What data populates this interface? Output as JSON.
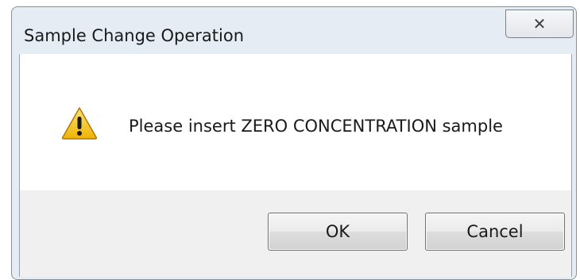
{
  "window": {
    "title": "Sample Change Operation",
    "close_glyph": "✕"
  },
  "message": {
    "icon": "warning-icon",
    "text": "Please insert ZERO CONCENTRATION sample"
  },
  "buttons": {
    "ok_label": "OK",
    "cancel_label": "Cancel"
  },
  "colors": {
    "frame": "#e6ecf3",
    "warning_yellow": "#f3c019",
    "button_area": "#f0f0f0"
  }
}
